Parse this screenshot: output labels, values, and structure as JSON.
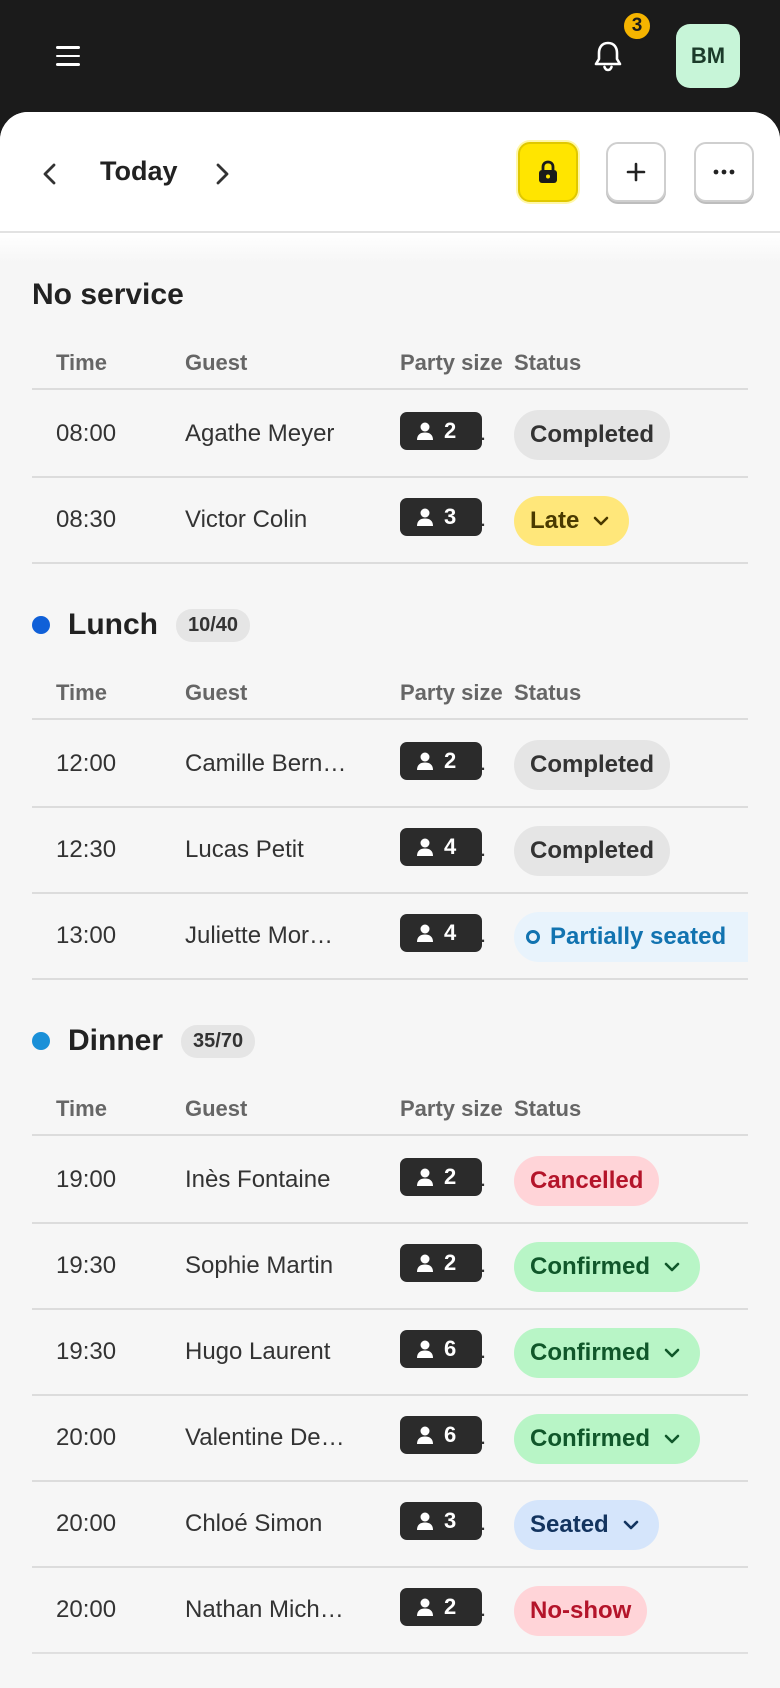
{
  "header": {
    "notification_count": "3",
    "avatar_initials": "BM"
  },
  "toolbar": {
    "date_label": "Today"
  },
  "colors": {
    "lunch_dot": "#1060d8",
    "dinner_dot": "#1a90d8",
    "lock_button": "#ffe500"
  },
  "columns": {
    "time": "Time",
    "guest": "Guest",
    "party_size": "Party size",
    "status": "Status"
  },
  "sections": [
    {
      "title": "No service",
      "count": "",
      "rows": [
        {
          "time": "08:00",
          "guest": "Agathe Meyer",
          "party": "2",
          "status": "Completed",
          "status_type": "completed",
          "has_menu": false
        },
        {
          "time": "08:30",
          "guest": "Victor Colin",
          "party": "3",
          "status": "Late",
          "status_type": "late",
          "has_menu": true
        }
      ]
    },
    {
      "title": "Lunch",
      "count": "10/40",
      "rows": [
        {
          "time": "12:00",
          "guest": "Camille Bern…",
          "party": "2",
          "status": "Completed",
          "status_type": "completed",
          "has_menu": false
        },
        {
          "time": "12:30",
          "guest": "Lucas Petit",
          "party": "4",
          "status": "Completed",
          "status_type": "completed",
          "has_menu": false
        },
        {
          "time": "13:00",
          "guest": "Juliette Mor…",
          "party": "4",
          "status": "Partially seated",
          "status_type": "partial",
          "has_menu": false
        }
      ]
    },
    {
      "title": "Dinner",
      "count": "35/70",
      "rows": [
        {
          "time": "19:00",
          "guest": "Inès Fontaine",
          "party": "2",
          "status": "Cancelled",
          "status_type": "cancelled",
          "has_menu": false
        },
        {
          "time": "19:30",
          "guest": "Sophie Martin",
          "party": "2",
          "status": "Confirmed",
          "status_type": "confirmed",
          "has_menu": true
        },
        {
          "time": "19:30",
          "guest": "Hugo Laurent",
          "party": "6",
          "status": "Confirmed",
          "status_type": "confirmed",
          "has_menu": true
        },
        {
          "time": "20:00",
          "guest": "Valentine De…",
          "party": "6",
          "status": "Confirmed",
          "status_type": "confirmed",
          "has_menu": true
        },
        {
          "time": "20:00",
          "guest": "Chloé Simon",
          "party": "3",
          "status": "Seated",
          "status_type": "seated",
          "has_menu": true
        },
        {
          "time": "20:00",
          "guest": "Nathan Mich…",
          "party": "2",
          "status": "No-show",
          "status_type": "noshow",
          "has_menu": false
        }
      ]
    }
  ]
}
